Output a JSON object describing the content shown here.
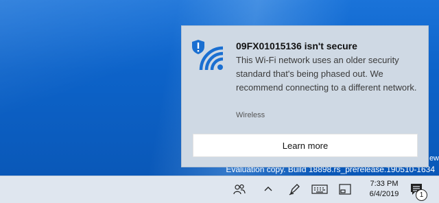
{
  "desktop": {
    "watermark_line1": "ew",
    "watermark_line2": "Evaluation copy. Build 18898.rs_prerelease.190510-1634"
  },
  "toast": {
    "title": "09FX01015136 isn't secure",
    "body": "This Wi-Fi network uses an older security standard that's being phased out. We recommend connecting to a different network.",
    "source": "Wireless",
    "action_label": "Learn more",
    "icon": "wifi-shield-warning-icon",
    "accent_color": "#1a6fd1"
  },
  "taskbar": {
    "people_icon": "people-icon",
    "overflow_icon": "chevron-up-icon",
    "pen_icon": "pen-icon",
    "keyboard_icon": "keyboard-icon",
    "tablet_icon": "tablet-icon",
    "time": "7:33 PM",
    "date": "6/4/2019",
    "notifications_icon": "action-center-icon",
    "notification_count": "1"
  }
}
